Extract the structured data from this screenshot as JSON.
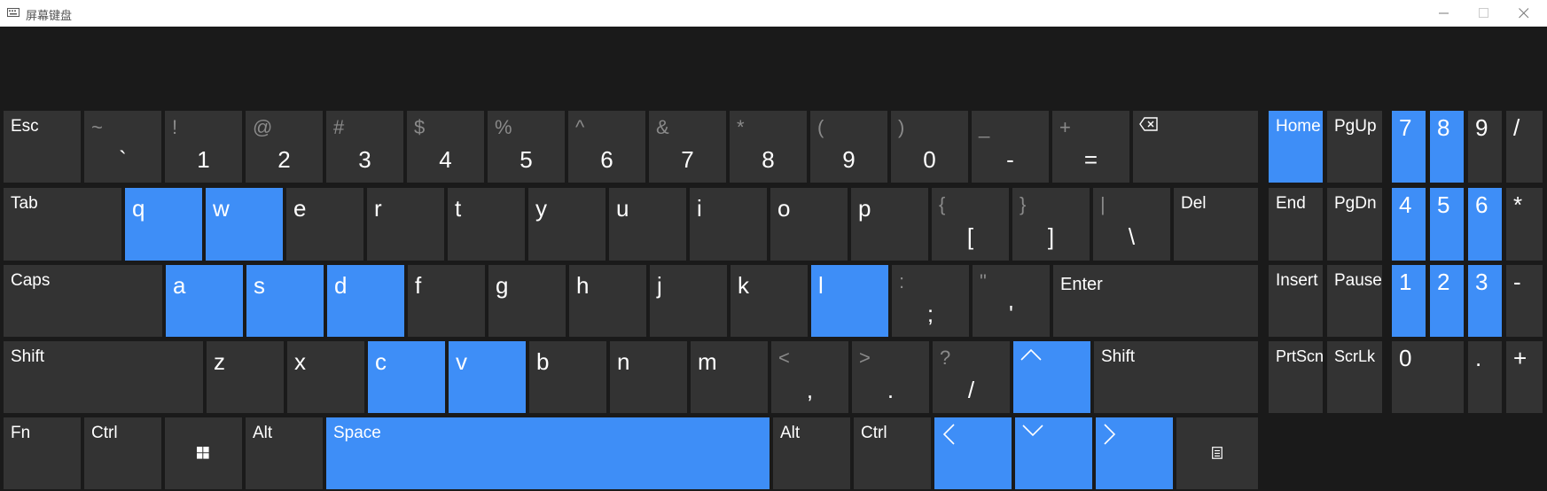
{
  "window": {
    "title": "屏幕键盘",
    "minimize_icon": "minimize-icon",
    "maximize_icon": "maximize-icon",
    "close_icon": "close-icon"
  },
  "colors": {
    "key": "#333333",
    "highlight": "#3e8ef7",
    "background": "#1a1a1a"
  },
  "row1": {
    "esc": "Esc",
    "keys": [
      {
        "shift": "~",
        "main": "`"
      },
      {
        "shift": "!",
        "main": "1"
      },
      {
        "shift": "@",
        "main": "2"
      },
      {
        "shift": "#",
        "main": "3"
      },
      {
        "shift": "$",
        "main": "4"
      },
      {
        "shift": "%",
        "main": "5"
      },
      {
        "shift": "^",
        "main": "6"
      },
      {
        "shift": "&",
        "main": "7"
      },
      {
        "shift": "*",
        "main": "8"
      },
      {
        "shift": "(",
        "main": "9"
      },
      {
        "shift": ")",
        "main": "0"
      },
      {
        "shift": "_",
        "main": "-"
      },
      {
        "shift": "+",
        "main": "="
      }
    ],
    "backspace_icon": "backspace-icon"
  },
  "row2": {
    "tab": "Tab",
    "letters": [
      "q",
      "w",
      "e",
      "r",
      "t",
      "y",
      "u",
      "i",
      "o",
      "p"
    ],
    "symbols": [
      {
        "shift": "{",
        "main": "["
      },
      {
        "shift": "}",
        "main": "]"
      },
      {
        "shift": "|",
        "main": "\\"
      }
    ],
    "del": "Del"
  },
  "row3": {
    "caps": "Caps",
    "letters": [
      "a",
      "s",
      "d",
      "f",
      "g",
      "h",
      "j",
      "k",
      "l"
    ],
    "symbols": [
      {
        "shift": ":",
        "main": ";"
      },
      {
        "shift": "\"",
        "main": "'"
      }
    ],
    "enter": "Enter"
  },
  "row4": {
    "shift_left": "Shift",
    "letters": [
      "z",
      "x",
      "c",
      "v",
      "b",
      "n",
      "m"
    ],
    "symbols": [
      {
        "shift": "<",
        "main": ","
      },
      {
        "shift": ">",
        "main": "."
      },
      {
        "shift": "?",
        "main": "/"
      }
    ],
    "up_icon": "arrow-up-icon",
    "shift_right": "Shift"
  },
  "row5": {
    "fn": "Fn",
    "ctrl_left": "Ctrl",
    "windows_icon": "windows-icon",
    "alt_left": "Alt",
    "space": "Space",
    "alt_right": "Alt",
    "ctrl_right": "Ctrl",
    "left_icon": "arrow-left-icon",
    "down_icon": "arrow-down-icon",
    "right_icon": "arrow-right-icon",
    "menu_icon": "context-menu-icon"
  },
  "nav": {
    "home": "Home",
    "pgup": "PgUp",
    "end": "End",
    "pgdn": "PgDn",
    "insert": "Insert",
    "pause": "Pause",
    "prtscn": "PrtScn",
    "scrlk": "ScrLk"
  },
  "numpad": {
    "r1": [
      "7",
      "8",
      "9",
      "/"
    ],
    "r2": [
      "4",
      "5",
      "6",
      "*"
    ],
    "r3": [
      "1",
      "2",
      "3",
      "-"
    ],
    "zero": "0",
    "dot": ".",
    "plus": "+"
  },
  "highlighted_keys": [
    "q",
    "w",
    "a",
    "s",
    "d",
    "l",
    "c",
    "v",
    "Space",
    "Home",
    "up",
    "left",
    "down",
    "right",
    "7",
    "8",
    "4",
    "5",
    "6",
    "1",
    "2",
    "3"
  ]
}
